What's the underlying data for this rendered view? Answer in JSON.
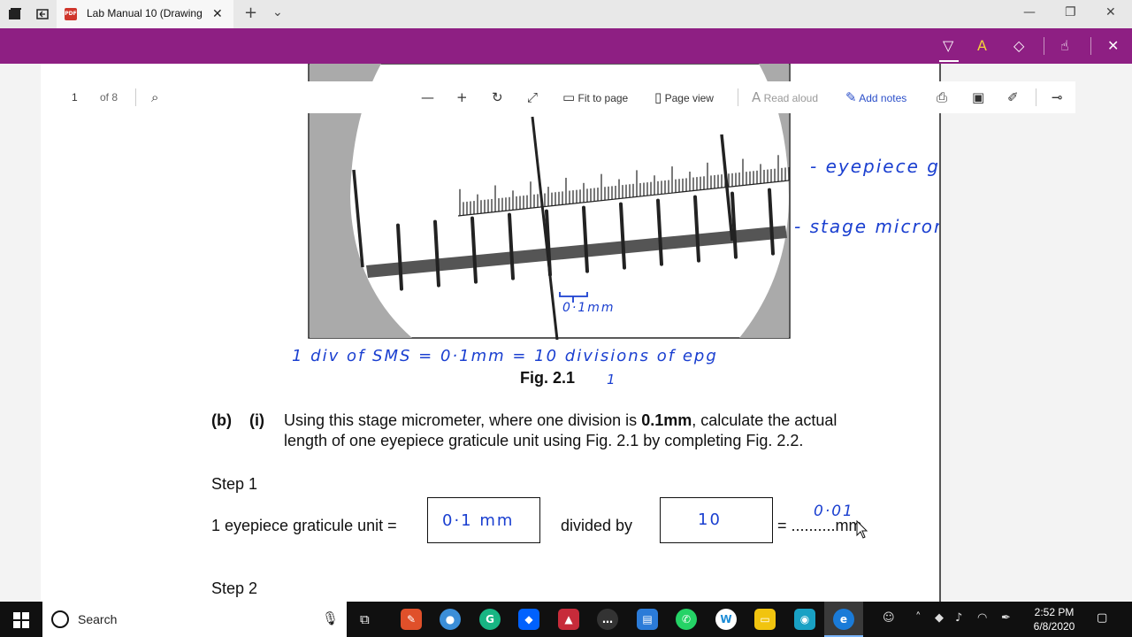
{
  "tab": {
    "title": "Lab Manual 10 (Drawing",
    "badge": "PDF"
  },
  "toolbar": {
    "page_number": "1",
    "page_total": "of 8",
    "fit_to_page": "Fit to page",
    "page_view": "Page view",
    "read_aloud": "Read aloud",
    "add_notes": "Add notes"
  },
  "figure": {
    "caption": "Fig. 2.1",
    "annotation_epg": "- eyepiece graticule (epg)",
    "annotation_sm": "- stage micrometer",
    "annotation_div": "0·1mm",
    "annotation_note": "1 div of SMS = 0·1mm = 10 divisions of epg",
    "annotation_one": "1"
  },
  "question": {
    "part": "(b)",
    "sub": "(i)",
    "line1_a": "Using this stage micrometer, where one division is ",
    "line1_b": "0.1mm",
    "line1_c": ", calculate the actual",
    "line2": "length of one eyepiece graticule unit using Fig. 2.1 by completing Fig. 2.2."
  },
  "steps": {
    "step1_label": "Step 1",
    "unit_label": "1 eyepiece graticule unit =",
    "box1_value": "0·1 mm",
    "divided_by": "divided by",
    "box2_value": "10",
    "equals": "= ",
    "dots": "..........",
    "answer": "0·01",
    "unit": "mm",
    "step2_label": "Step 2"
  },
  "taskbar": {
    "search_label": "Search",
    "time": "2:52 PM",
    "date": "6/8/2020"
  },
  "colors": {
    "accent": "#8e1f83",
    "ink": "#1a3fd0"
  }
}
